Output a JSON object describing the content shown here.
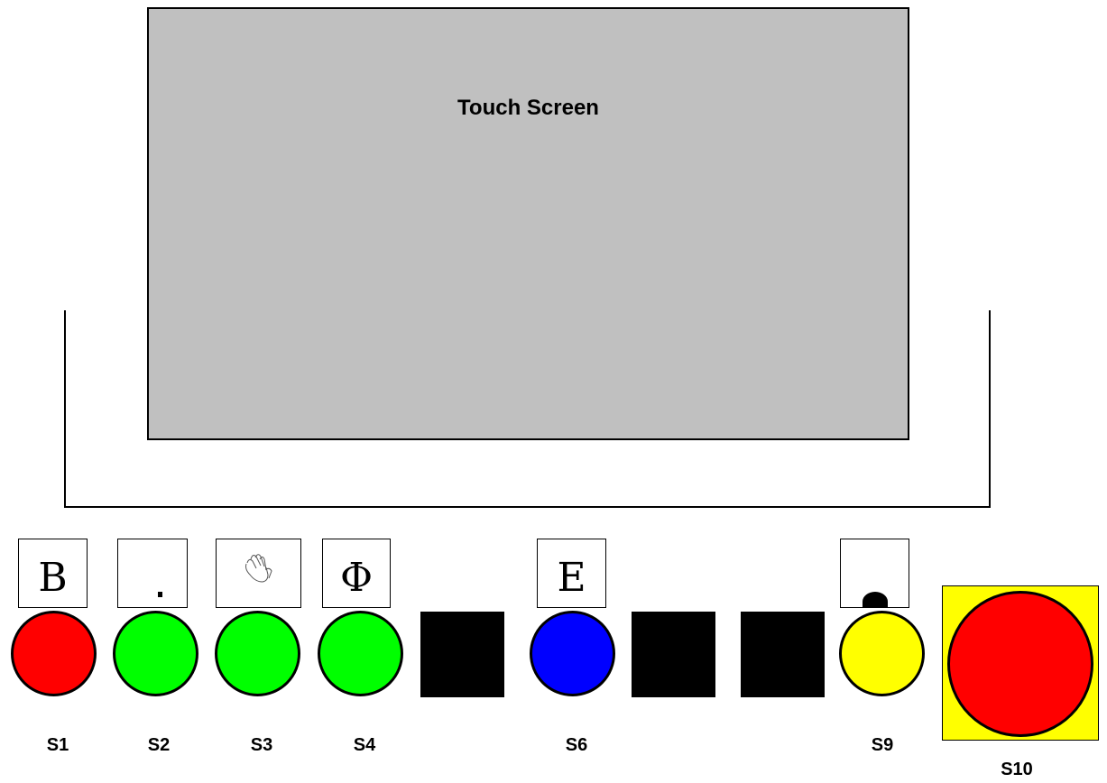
{
  "touch_screen": {
    "title": "Touch Screen",
    "fill": "#c0c0c0"
  },
  "symbols": {
    "s1": "B",
    "s2": "dot-icon",
    "s3": "hand-icon",
    "s4": "Φ",
    "s6": "E",
    "s9": "arc-icon"
  },
  "buttons": [
    {
      "id": "S1",
      "label": "S1",
      "color": "#ff0000"
    },
    {
      "id": "S2",
      "label": "S2",
      "color": "#00ff00"
    },
    {
      "id": "S3",
      "label": "S3",
      "color": "#00ff00"
    },
    {
      "id": "S4",
      "label": "S4",
      "color": "#00ff00"
    },
    {
      "id": "S6",
      "label": "S6",
      "color": "#0000ff"
    },
    {
      "id": "S9",
      "label": "S9",
      "color": "#ffff00"
    },
    {
      "id": "S10",
      "label": "S10",
      "color": "#ff0000",
      "plate_color": "#ffff00"
    }
  ],
  "blank_positions_color": "#000000"
}
